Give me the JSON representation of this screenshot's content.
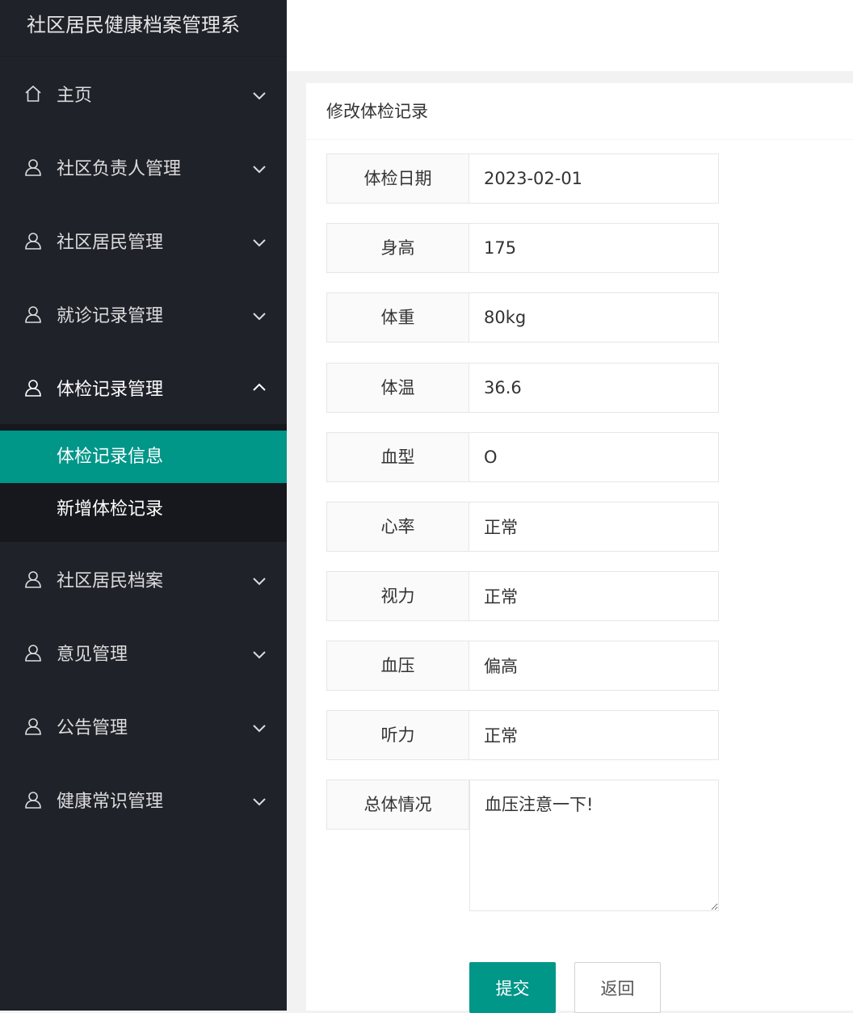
{
  "app": {
    "title": "社区居民健康档案管理系"
  },
  "sidebar": {
    "items": [
      {
        "label": "主页",
        "icon": "home-icon"
      },
      {
        "label": "社区负责人管理",
        "icon": "user-icon"
      },
      {
        "label": "社区居民管理",
        "icon": "user-icon"
      },
      {
        "label": "就诊记录管理",
        "icon": "user-icon"
      },
      {
        "label": "体检记录管理",
        "icon": "user-icon",
        "open": true,
        "children": [
          {
            "label": "体检记录信息",
            "active": true
          },
          {
            "label": "新增体检记录"
          }
        ]
      },
      {
        "label": "社区居民档案",
        "icon": "user-icon"
      },
      {
        "label": "意见管理",
        "icon": "user-icon"
      },
      {
        "label": "公告管理",
        "icon": "user-icon"
      },
      {
        "label": "健康常识管理",
        "icon": "user-icon"
      }
    ]
  },
  "form": {
    "title": "修改体检记录",
    "fields": [
      {
        "label": "体检日期",
        "value": "2023-02-01"
      },
      {
        "label": "身高",
        "value": "175"
      },
      {
        "label": "体重",
        "value": "80kg"
      },
      {
        "label": "体温",
        "value": "36.6"
      },
      {
        "label": "血型",
        "value": "O"
      },
      {
        "label": "心率",
        "value": "正常"
      },
      {
        "label": "视力",
        "value": "正常"
      },
      {
        "label": "血压",
        "value": "偏高"
      },
      {
        "label": "听力",
        "value": "正常"
      }
    ],
    "summary": {
      "label": "总体情况",
      "value": "血压注意一下!"
    },
    "submit_label": "提交",
    "back_label": "返回"
  },
  "colors": {
    "accent": "#009688",
    "sidebar_bg": "#20222a",
    "submenu_bg": "#17181d"
  }
}
